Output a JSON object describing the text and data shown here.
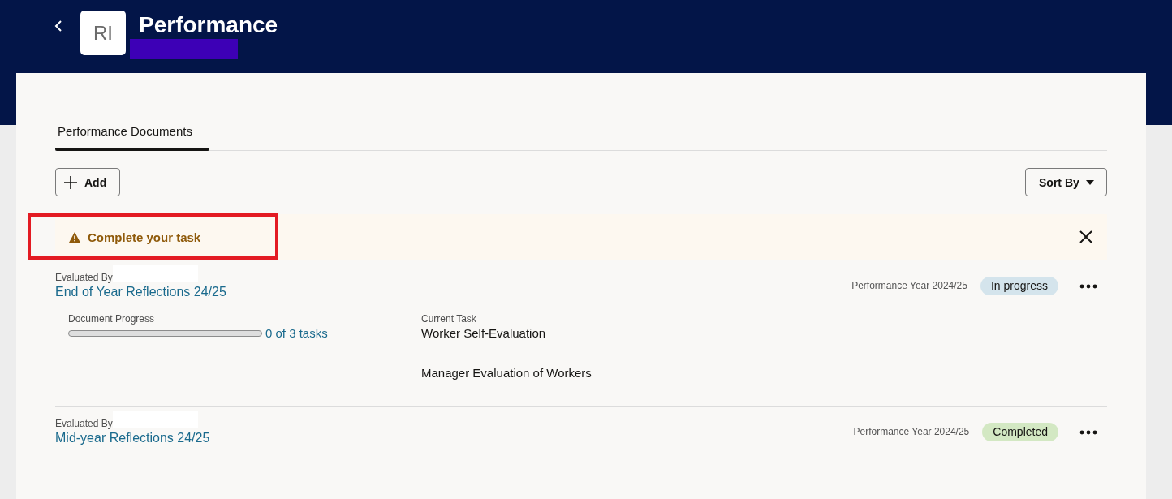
{
  "header": {
    "avatar_initials": "RI",
    "title": "Performance"
  },
  "tabs": [
    {
      "label": "Performance Documents",
      "selected": true
    }
  ],
  "toolbar": {
    "add_button": "Add",
    "sort_button": "Sort By"
  },
  "alert": {
    "message": "Complete your task",
    "highlighted": true
  },
  "documents": [
    {
      "evaluated_by_label": "Evaluated By",
      "title": "End of Year Reflections 24/25",
      "performance_year": "Performance Year 2024/25",
      "status": {
        "label": "In progress",
        "color": "#d4e4ec"
      },
      "progress": {
        "label": "Document Progress",
        "level": 0,
        "reading": "0 of 3 tasks"
      },
      "current_task": {
        "label": "Current Task",
        "tasks": [
          "Worker Self-Evaluation",
          "Manager Evaluation of Workers"
        ]
      }
    },
    {
      "evaluated_by_label": "Evaluated By",
      "title": "Mid-year Reflections 24/25",
      "performance_year": "Performance Year 2024/25",
      "status": {
        "label": "Completed",
        "color": "#d3e8c3"
      }
    }
  ]
}
